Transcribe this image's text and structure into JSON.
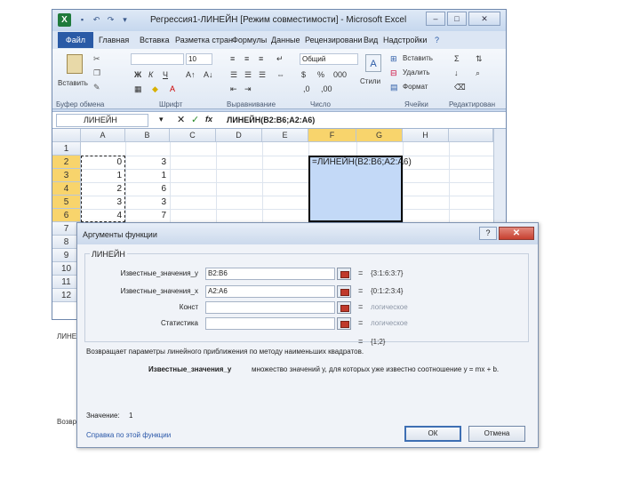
{
  "excel": {
    "title": "Регрессия1-ЛИНЕЙН  [Режим совместимости] - Microsoft Excel",
    "logo": "X",
    "menu": [
      "Файл",
      "Главная",
      "Вставка",
      "Разметка стран",
      "Формулы",
      "Данные",
      "Рецензировани",
      "Вид",
      "Надстройки"
    ],
    "ribbon": {
      "paste": "Вставить",
      "font_size": "10",
      "number_format": "Общий",
      "insert": "Вставить",
      "delete": "Удалить",
      "format": "Формат",
      "styles": "Стили",
      "groups": [
        "Буфер обмена",
        "Шрифт",
        "Выравнивание",
        "Число",
        "Ячейки",
        "Редактирован"
      ]
    },
    "name_box": "ЛИНЕЙН",
    "formula": "ЛИНЕЙН(B2:B6;A2:A6)",
    "columns": [
      "A",
      "B",
      "C",
      "D",
      "E",
      "F",
      "G",
      "H"
    ],
    "rows": [
      "1",
      "2",
      "3",
      "4",
      "5",
      "6",
      "7",
      "8",
      "9",
      "10",
      "11",
      "12"
    ],
    "col_a": [
      "0",
      "1",
      "2",
      "3",
      "4"
    ],
    "col_b": [
      "3",
      "1",
      "6",
      "3",
      "7"
    ],
    "cell_formula": "=ЛИНЕЙН(B2:B6;A2:A6)"
  },
  "dialog": {
    "title": "Аргументы функции",
    "help_label": "?",
    "close_label": "✕",
    "function_name": "ЛИНЕЙН",
    "args": [
      {
        "label": "Известные_значения_y",
        "value": "B2:B6",
        "result": "{3:1:6:3:7}",
        "grey": false
      },
      {
        "label": "Известные_значения_x",
        "value": "A2:A6",
        "result": "{0:1:2:3:4}",
        "grey": false
      },
      {
        "label": "Конст",
        "value": "",
        "result": "логическое",
        "grey": true
      },
      {
        "label": "Статистика",
        "value": "",
        "result": "логическое",
        "grey": true
      }
    ],
    "eq_sign": "=",
    "result_preview": "{1;2}",
    "description": "Возвращает параметры линейного приближения по методу наименьших квадратов.",
    "arg_help_name": "Известные_значения_y",
    "arg_help_text": "множество значений y, для которых уже известно соотношение y = mx + b.",
    "value_label": "Значение:",
    "value": "1",
    "help_link": "Справка по этой функции",
    "ok": "ОК",
    "cancel": "Отмена"
  },
  "behind": {
    "left_label": "ЛИНЕЙ",
    "bottom_label": "Возвр"
  }
}
